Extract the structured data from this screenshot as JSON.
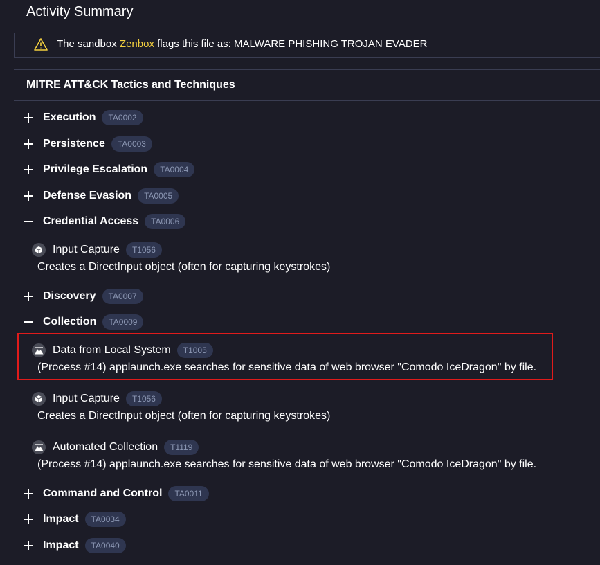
{
  "header": {
    "title": "Activity Summary"
  },
  "flag": {
    "prefix": "The sandbox",
    "sandbox": "Zenbox",
    "suffix": "flags this file as: MALWARE PHISHING TROJAN EVADER",
    "accent": "#f4d03f"
  },
  "mitre": {
    "heading": "MITRE ATT&CK Tactics and Techniques",
    "tactics": [
      {
        "name": "Execution",
        "id": "TA0002",
        "toggle": "plus"
      },
      {
        "name": "Persistence",
        "id": "TA0003",
        "toggle": "plus"
      },
      {
        "name": "Privilege Escalation",
        "id": "TA0004",
        "toggle": "plus"
      },
      {
        "name": "Defense Evasion",
        "id": "TA0005",
        "toggle": "plus"
      },
      {
        "name": "Credential Access",
        "id": "TA0006",
        "toggle": "minus"
      },
      {
        "name": "Discovery",
        "id": "TA0007",
        "toggle": "plus"
      },
      {
        "name": "Collection",
        "id": "TA0009",
        "toggle": "minus"
      },
      {
        "name": "Command and Control",
        "id": "TA0011",
        "toggle": "plus"
      },
      {
        "name": "Impact",
        "id": "TA0034",
        "toggle": "plus"
      },
      {
        "name": "Impact",
        "id": "TA0040",
        "toggle": "plus"
      }
    ],
    "techniques": [
      {
        "name": "Input Capture",
        "id": "T1056",
        "icon": "cube-icon",
        "desc": "Creates a DirectInput object (often for capturing keystrokes)"
      },
      {
        "name": "Data from Local System",
        "id": "T1005",
        "icon": "mountain-icon",
        "desc": "(Process #14) applaunch.exe searches for sensitive data of web browser \"Comodo IceDragon\" by file."
      },
      {
        "name": "Input Capture",
        "id": "T1056",
        "icon": "cube-icon",
        "desc": "Creates a DirectInput object (often for capturing keystrokes)"
      },
      {
        "name": "Automated Collection",
        "id": "T1119",
        "icon": "mountain-icon",
        "desc": "(Process #14) applaunch.exe searches for sensitive data of web browser \"Comodo IceDragon\" by file."
      }
    ]
  },
  "colors": {
    "background": "#1c1c27",
    "pill": "#2f3650",
    "highlight": "#e01b1b"
  }
}
